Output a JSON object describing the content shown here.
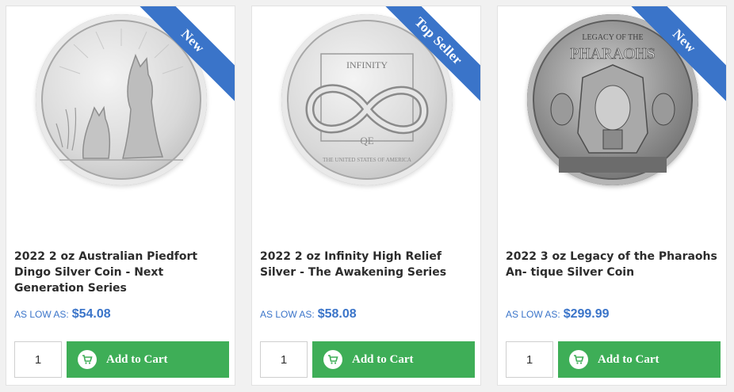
{
  "products": [
    {
      "badge": "New",
      "image_icon": "dingo-coin-image",
      "title": "2022 2 oz Australian Piedfort Dingo Silver Coin - Next Generation Series",
      "price_label": "AS LOW AS:",
      "price": "$54.08",
      "quantity": "1",
      "add_to_cart_label": "Add to Cart"
    },
    {
      "badge": "Top Seller",
      "image_icon": "infinity-coin-image",
      "coin_text_top": "INFINITY",
      "coin_text_mid": "QE",
      "coin_text_bottom": "THE UNITED STATES OF AMERICA",
      "title": "2022 2 oz Infinity High Relief Silver - The Awakening Series",
      "price_label": "AS LOW AS:",
      "price": "$58.08",
      "quantity": "1",
      "add_to_cart_label": "Add to Cart"
    },
    {
      "badge": "New",
      "image_icon": "pharaohs-coin-image",
      "coin_text_top": "LEGACY OF THE",
      "coin_text_mid": "PHARAOHS",
      "title": "2022 3 oz Legacy of the Pharaohs An- tique Silver Coin",
      "price_label": "AS LOW AS:",
      "price": "$299.99",
      "quantity": "1",
      "add_to_cart_label": "Add to Cart"
    }
  ],
  "colors": {
    "ribbon": "#3a74c9",
    "price": "#3a74c9",
    "add_to_cart": "#3eae57",
    "title": "#2c2c2c"
  }
}
